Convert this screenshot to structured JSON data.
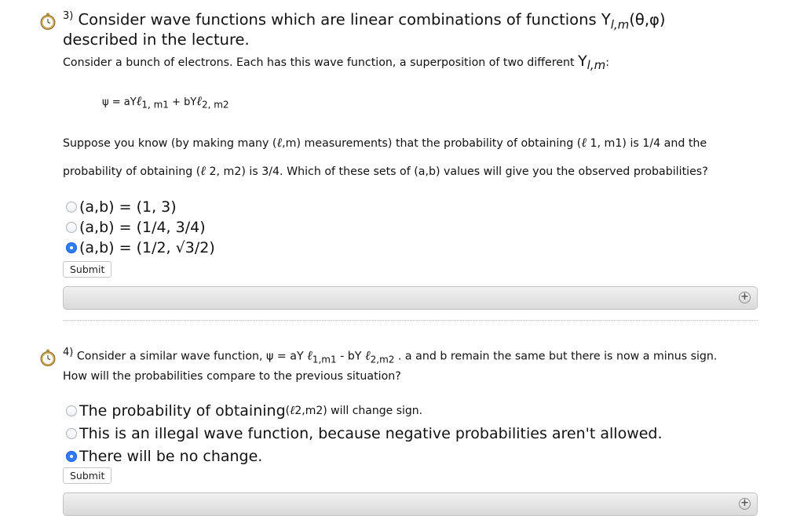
{
  "q3": {
    "number": "3)",
    "title_part1": "Consider wave functions which are linear combinations of functions Y",
    "title_sub": "l,m",
    "title_part2": "(θ,φ)",
    "title_line2": "described in the lecture.",
    "intro": "Consider a bunch of electrons. Each has this wave function, a superposition of two different ",
    "intro_Y": "Y",
    "intro_sub": "l,m",
    "intro_end": ":",
    "equation": {
      "psi_a": "ψ = aY",
      "l1": "ℓ",
      "sub1": "1, m1",
      "plus_b": " + bY",
      "l2": "ℓ",
      "sub2": "2, m2"
    },
    "para_line1_a": "Suppose you know (by making many (",
    "para_line1_l": "ℓ",
    "para_line1_b": ",m) measurements) that the probability of obtaining (",
    "para_line1_l2": "ℓ",
    "para_line1_c": " 1, m1) is 1/4 and the",
    "para_line2_a": "probability of obtaining (",
    "para_line2_l": "ℓ",
    "para_line2_b": " 2, m2) is 3/4. Which of these sets of (a,b) values will give you the observed probabilities?",
    "options": [
      {
        "label": "(a,b) = (1, 3)",
        "checked": false
      },
      {
        "label": "(a,b) = (1/4, 3/4)",
        "checked": false
      },
      {
        "label": "(a,b) = (1/2, √3/2)",
        "checked": true
      }
    ],
    "submit_label": "Submit"
  },
  "q4": {
    "number": "4)",
    "line1_a": "Consider a similar wave function, ψ = aY ",
    "l1": "ℓ",
    "sub1": "1,m1",
    "mid": " - bY ",
    "l2": "ℓ",
    "sub2": "2,m2",
    "line1_end": " . a and b remain the same but there is now a minus sign.",
    "line2": "How will the probabilities compare to the previous situation?",
    "options": [
      {
        "label": "The probability of obtaining ",
        "small_l": "ℓ",
        "small_rest": "2,m2) will change sign.",
        "small_paren": "(",
        "checked": false
      },
      {
        "label": "This is an illegal wave function, because negative probabilities aren't allowed.",
        "checked": false
      },
      {
        "label": "There will be no change.",
        "checked": true
      }
    ],
    "submit_label": "Submit"
  },
  "expand_icon": "plus-circle-icon",
  "question_icon": "stopwatch-icon"
}
